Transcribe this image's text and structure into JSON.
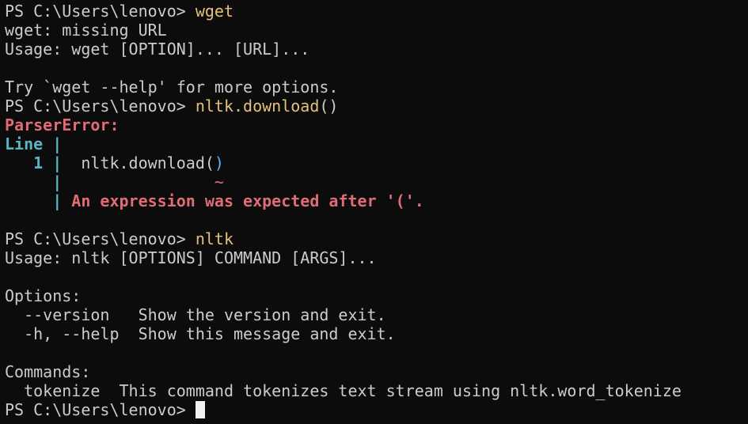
{
  "terminal": {
    "colors": {
      "background": "#0c0c0c",
      "text": "#cccccc",
      "command": "#e5c07b",
      "error": "#e06c75",
      "line_marker": "#56b6c2"
    },
    "prompt": "PS C:\\Users\\lenovo> ",
    "cmd1": "wget",
    "wget_missing": "wget: missing URL",
    "wget_usage": "Usage: wget [OPTION]... [URL]...",
    "wget_try": "Try `wget --help' for more options.",
    "cmd2_name": "nltk.download",
    "cmd2_paren": "()",
    "parser_error": "ParserError:",
    "line_label": "Line |",
    "line_number": "   1 |",
    "code_text": "  nltk.download(",
    "code_close": ")",
    "blank_pipe": "     |",
    "tilde_pad": "                ",
    "tilde": "~",
    "error_pipe": "     |",
    "error_message": " An expression was expected after '('.",
    "cmd3": "nltk",
    "nltk_usage": "Usage: nltk [OPTIONS] COMMAND [ARGS]...",
    "options_header": "Options:",
    "opt_version": "  --version   Show the version and exit.",
    "opt_help": "  -h, --help  Show this message and exit.",
    "commands_header": "Commands:",
    "cmd_tokenize": "  tokenize  This command tokenizes text stream using nltk.word_tokenize"
  }
}
